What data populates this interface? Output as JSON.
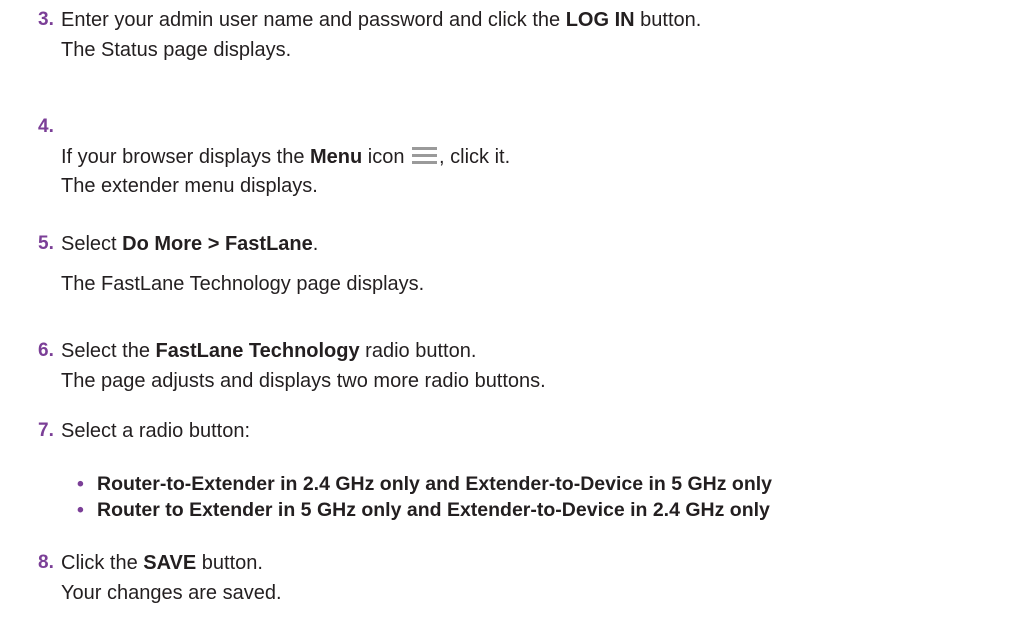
{
  "accent_color": "#7b3f97",
  "steps": [
    {
      "number": "3.",
      "l1_a": "Enter your admin user name and password and click the ",
      "l1_b": "LOG IN",
      "l1_c": " button.",
      "l2": "The Status page displays."
    },
    {
      "number": "4.",
      "l1_a": "If your browser displays the ",
      "l1_b": "Menu",
      "l1_c": " icon ",
      "l1_d": ", click it.",
      "l2": "The extender menu displays."
    },
    {
      "number": "5.",
      "l1_a": "Select ",
      "l1_b": "Do More > FastLane",
      "l1_c": ".",
      "l2": "The FastLane Technology page displays."
    },
    {
      "number": "6.",
      "l1_a": "Select the ",
      "l1_b": "FastLane Technology",
      "l1_c": " radio button.",
      "l2": "The page adjusts and displays two more radio buttons."
    },
    {
      "number": "7.",
      "l1_a": "Select a radio button:",
      "bullets": [
        "Router-to-Extender in 2.4 GHz only and Extender-to-Device in 5 GHz only",
        "Router to Extender in 5 GHz only and Extender-to-Device in 2.4 GHz only"
      ],
      "bullet_glyph": "•"
    },
    {
      "number": "8.",
      "l1_a": "Click the ",
      "l1_b": "SAVE",
      "l1_c": " button.",
      "l2": "Your changes are saved."
    }
  ],
  "icons": {
    "menu": "hamburger-menu-icon"
  }
}
